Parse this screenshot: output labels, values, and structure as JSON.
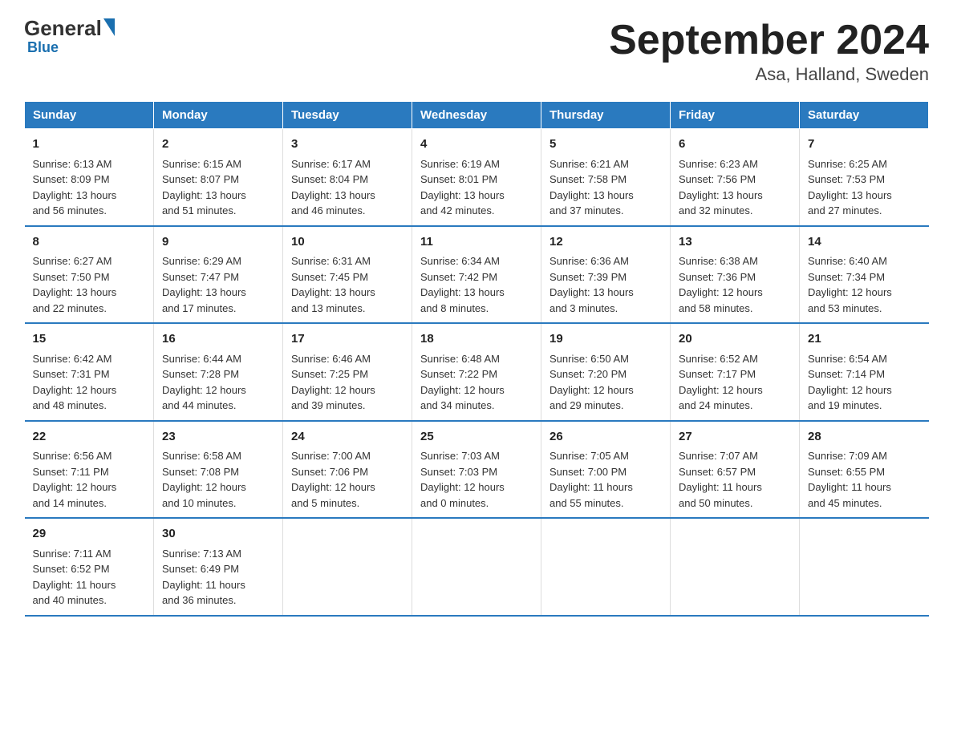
{
  "logo": {
    "general": "General",
    "blue": "Blue"
  },
  "title": "September 2024",
  "subtitle": "Asa, Halland, Sweden",
  "days": [
    "Sunday",
    "Monday",
    "Tuesday",
    "Wednesday",
    "Thursday",
    "Friday",
    "Saturday"
  ],
  "weeks": [
    [
      {
        "num": "1",
        "sunrise": "6:13 AM",
        "sunset": "8:09 PM",
        "daylight": "13 hours and 56 minutes."
      },
      {
        "num": "2",
        "sunrise": "6:15 AM",
        "sunset": "8:07 PM",
        "daylight": "13 hours and 51 minutes."
      },
      {
        "num": "3",
        "sunrise": "6:17 AM",
        "sunset": "8:04 PM",
        "daylight": "13 hours and 46 minutes."
      },
      {
        "num": "4",
        "sunrise": "6:19 AM",
        "sunset": "8:01 PM",
        "daylight": "13 hours and 42 minutes."
      },
      {
        "num": "5",
        "sunrise": "6:21 AM",
        "sunset": "7:58 PM",
        "daylight": "13 hours and 37 minutes."
      },
      {
        "num": "6",
        "sunrise": "6:23 AM",
        "sunset": "7:56 PM",
        "daylight": "13 hours and 32 minutes."
      },
      {
        "num": "7",
        "sunrise": "6:25 AM",
        "sunset": "7:53 PM",
        "daylight": "13 hours and 27 minutes."
      }
    ],
    [
      {
        "num": "8",
        "sunrise": "6:27 AM",
        "sunset": "7:50 PM",
        "daylight": "13 hours and 22 minutes."
      },
      {
        "num": "9",
        "sunrise": "6:29 AM",
        "sunset": "7:47 PM",
        "daylight": "13 hours and 17 minutes."
      },
      {
        "num": "10",
        "sunrise": "6:31 AM",
        "sunset": "7:45 PM",
        "daylight": "13 hours and 13 minutes."
      },
      {
        "num": "11",
        "sunrise": "6:34 AM",
        "sunset": "7:42 PM",
        "daylight": "13 hours and 8 minutes."
      },
      {
        "num": "12",
        "sunrise": "6:36 AM",
        "sunset": "7:39 PM",
        "daylight": "13 hours and 3 minutes."
      },
      {
        "num": "13",
        "sunrise": "6:38 AM",
        "sunset": "7:36 PM",
        "daylight": "12 hours and 58 minutes."
      },
      {
        "num": "14",
        "sunrise": "6:40 AM",
        "sunset": "7:34 PM",
        "daylight": "12 hours and 53 minutes."
      }
    ],
    [
      {
        "num": "15",
        "sunrise": "6:42 AM",
        "sunset": "7:31 PM",
        "daylight": "12 hours and 48 minutes."
      },
      {
        "num": "16",
        "sunrise": "6:44 AM",
        "sunset": "7:28 PM",
        "daylight": "12 hours and 44 minutes."
      },
      {
        "num": "17",
        "sunrise": "6:46 AM",
        "sunset": "7:25 PM",
        "daylight": "12 hours and 39 minutes."
      },
      {
        "num": "18",
        "sunrise": "6:48 AM",
        "sunset": "7:22 PM",
        "daylight": "12 hours and 34 minutes."
      },
      {
        "num": "19",
        "sunrise": "6:50 AM",
        "sunset": "7:20 PM",
        "daylight": "12 hours and 29 minutes."
      },
      {
        "num": "20",
        "sunrise": "6:52 AM",
        "sunset": "7:17 PM",
        "daylight": "12 hours and 24 minutes."
      },
      {
        "num": "21",
        "sunrise": "6:54 AM",
        "sunset": "7:14 PM",
        "daylight": "12 hours and 19 minutes."
      }
    ],
    [
      {
        "num": "22",
        "sunrise": "6:56 AM",
        "sunset": "7:11 PM",
        "daylight": "12 hours and 14 minutes."
      },
      {
        "num": "23",
        "sunrise": "6:58 AM",
        "sunset": "7:08 PM",
        "daylight": "12 hours and 10 minutes."
      },
      {
        "num": "24",
        "sunrise": "7:00 AM",
        "sunset": "7:06 PM",
        "daylight": "12 hours and 5 minutes."
      },
      {
        "num": "25",
        "sunrise": "7:03 AM",
        "sunset": "7:03 PM",
        "daylight": "12 hours and 0 minutes."
      },
      {
        "num": "26",
        "sunrise": "7:05 AM",
        "sunset": "7:00 PM",
        "daylight": "11 hours and 55 minutes."
      },
      {
        "num": "27",
        "sunrise": "7:07 AM",
        "sunset": "6:57 PM",
        "daylight": "11 hours and 50 minutes."
      },
      {
        "num": "28",
        "sunrise": "7:09 AM",
        "sunset": "6:55 PM",
        "daylight": "11 hours and 45 minutes."
      }
    ],
    [
      {
        "num": "29",
        "sunrise": "7:11 AM",
        "sunset": "6:52 PM",
        "daylight": "11 hours and 40 minutes."
      },
      {
        "num": "30",
        "sunrise": "7:13 AM",
        "sunset": "6:49 PM",
        "daylight": "11 hours and 36 minutes."
      },
      null,
      null,
      null,
      null,
      null
    ]
  ]
}
